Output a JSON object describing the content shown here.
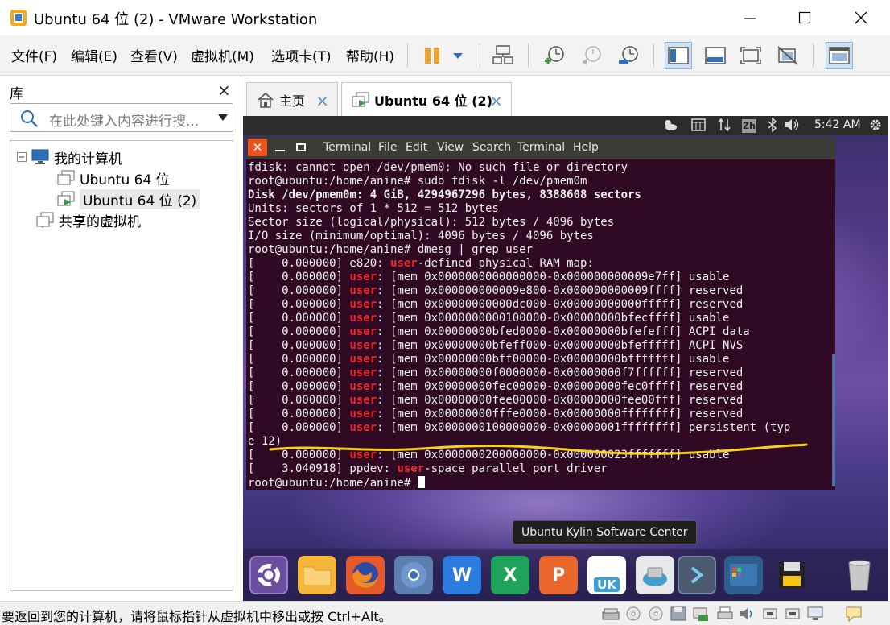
{
  "window": {
    "title": "Ubuntu 64 位 (2) - VMware Workstation",
    "minimize_icon": "minimize-icon",
    "maximize_icon": "maximize-icon",
    "close_icon": "close-icon"
  },
  "menu": {
    "items": [
      "文件(F)",
      "编辑(E)",
      "查看(V)",
      "虚拟机(M)",
      "选项卡(T)",
      "帮助(H)"
    ]
  },
  "toolbar": {
    "icons": [
      "pause-icon",
      "dropdown-icon",
      "send-ctrl-alt-del-icon",
      "snapshot-take-icon",
      "snapshot-revert-icon",
      "snapshot-manager-icon",
      "show-library-icon",
      "fullscreen-icon",
      "autofit-icon",
      "unity-icon",
      "console-view-icon"
    ]
  },
  "library": {
    "title": "库",
    "close": "×",
    "search_placeholder": "在此处键入内容进行搜...",
    "tree": {
      "root": "我的计算机",
      "children": [
        "Ubuntu 64 位",
        "Ubuntu 64 位 (2)"
      ],
      "shared": "共享的虚拟机"
    }
  },
  "tabs": [
    {
      "label": "主页",
      "close": "×"
    },
    {
      "label": "Ubuntu 64 位 (2)",
      "close": "×"
    }
  ],
  "guest": {
    "panel": {
      "clock": "5:42 AM",
      "ime": "Zh"
    },
    "terminal": {
      "menu": [
        "Terminal",
        "File",
        "Edit",
        "View",
        "Search",
        "Terminal",
        "Help"
      ],
      "lines": [
        [
          {
            "t": "fdisk: cannot open /dev/pmem0: No such file or directory"
          }
        ],
        [
          {
            "t": "root@ubuntu:/home/anine# sudo fdisk -l /dev/pmem0m"
          }
        ],
        [
          {
            "t": "Disk /dev/pmem0m: 4 GiB, 4294967296 bytes, 8388608 sectors",
            "s": "b"
          }
        ],
        [
          {
            "t": "Units: sectors of 1 * 512 = 512 bytes"
          }
        ],
        [
          {
            "t": "Sector size (logical/physical): 512 bytes / 4096 bytes"
          }
        ],
        [
          {
            "t": "I/O size (minimum/optimal): 4096 bytes / 4096 bytes"
          }
        ],
        [
          {
            "t": "root@ubuntu:/home/anine# dmesg | grep user"
          }
        ],
        [
          {
            "t": "[    0.000000] e820: "
          },
          {
            "t": "user",
            "s": "hl"
          },
          {
            "t": "-defined physical RAM map:"
          }
        ],
        [
          {
            "t": "[    0.000000] "
          },
          {
            "t": "user",
            "s": "hl"
          },
          {
            "t": ": [mem 0x0000000000000000-0x000000000009e7ff] usable"
          }
        ],
        [
          {
            "t": "[    0.000000] "
          },
          {
            "t": "user",
            "s": "hl"
          },
          {
            "t": ": [mem 0x000000000009e800-0x000000000009ffff] reserved"
          }
        ],
        [
          {
            "t": "[    0.000000] "
          },
          {
            "t": "user",
            "s": "hl"
          },
          {
            "t": ": [mem 0x00000000000dc000-0x00000000000fffff] reserved"
          }
        ],
        [
          {
            "t": "[    0.000000] "
          },
          {
            "t": "user",
            "s": "hl"
          },
          {
            "t": ": [mem 0x0000000000100000-0x00000000bfecffff] usable"
          }
        ],
        [
          {
            "t": "[    0.000000] "
          },
          {
            "t": "user",
            "s": "hl"
          },
          {
            "t": ": [mem 0x00000000bfed0000-0x00000000bfefefff] ACPI data"
          }
        ],
        [
          {
            "t": "[    0.000000] "
          },
          {
            "t": "user",
            "s": "hl"
          },
          {
            "t": ": [mem 0x00000000bfeff000-0x00000000bfefffff] ACPI NVS"
          }
        ],
        [
          {
            "t": "[    0.000000] "
          },
          {
            "t": "user",
            "s": "hl"
          },
          {
            "t": ": [mem 0x00000000bff00000-0x00000000bfffffff] usable"
          }
        ],
        [
          {
            "t": "[    0.000000] "
          },
          {
            "t": "user",
            "s": "hl"
          },
          {
            "t": ": [mem 0x00000000f0000000-0x00000000f7ffffff] reserved"
          }
        ],
        [
          {
            "t": "[    0.000000] "
          },
          {
            "t": "user",
            "s": "hl"
          },
          {
            "t": ": [mem 0x00000000fec00000-0x00000000fec0ffff] reserved"
          }
        ],
        [
          {
            "t": "[    0.000000] "
          },
          {
            "t": "user",
            "s": "hl"
          },
          {
            "t": ": [mem 0x00000000fee00000-0x00000000fee00fff] reserved"
          }
        ],
        [
          {
            "t": "[    0.000000] "
          },
          {
            "t": "user",
            "s": "hl"
          },
          {
            "t": ": [mem 0x00000000fffe0000-0x00000000ffffffff] reserved"
          }
        ],
        [
          {
            "t": "[    0.000000] "
          },
          {
            "t": "user",
            "s": "hl"
          },
          {
            "t": ": [mem 0x0000000100000000-0x00000001ffffffff] persistent (typ"
          }
        ],
        [
          {
            "t": "e 12)"
          }
        ],
        [
          {
            "t": "[    0.000000] "
          },
          {
            "t": "user",
            "s": "hl"
          },
          {
            "t": ": [mem 0x0000000200000000-0x000000023fffffff] usable"
          }
        ],
        [
          {
            "t": "[    3.040918] ppdev: "
          },
          {
            "t": "user",
            "s": "hl"
          },
          {
            "t": "-space parallel port driver"
          }
        ],
        [
          {
            "t": "root@ubuntu:/home/anine# "
          }
        ]
      ]
    },
    "tooltip": "Ubuntu Kylin Software Center",
    "dock": {
      "icons": [
        "ubuntu-kylin-start-icon",
        "files-icon",
        "firefox-icon",
        "chromium-icon",
        "wps-writer-icon",
        "wps-spreadsheets-icon",
        "wps-presentation-icon",
        "software-center-icon",
        "installer-icon",
        "terminal-icon",
        "workspace-switcher-icon",
        "floppy-icon",
        "trash-icon"
      ],
      "uk_label": "UK"
    }
  },
  "statusbar": {
    "message": "要返回到您的计算机，请将鼠标指针从虚拟机中移出或按 Ctrl+Alt。"
  },
  "colors": {
    "terminal_bg": "#300a24",
    "highlight_red": "#ef2929",
    "underline_yellow": "#f7d21a",
    "ubuntu_orange": "#e95420"
  }
}
